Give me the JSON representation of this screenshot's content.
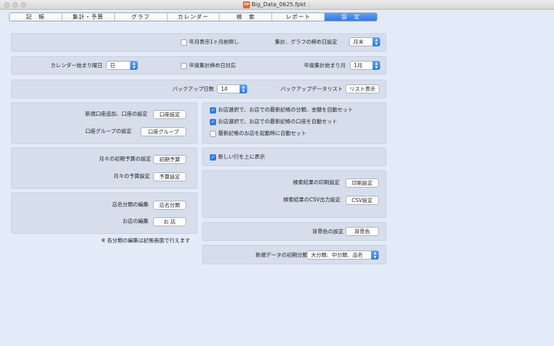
{
  "window": {
    "title": "Big_Data_0625.fpkt",
    "app_icon": "FP"
  },
  "tabs": [
    "記　帳",
    "集計・予算",
    "グラフ",
    "カレンダー",
    "検　索",
    "レポート",
    "設　定"
  ],
  "row1": {
    "checkbox_label": "年月表示1ヶ月前倒し",
    "closing_label": "集計、グラフの締め日設定",
    "closing_value": "月末"
  },
  "row2": {
    "weekstart_label": "カレンダー始まり曜日",
    "weekstart_value": "日",
    "checkbox_label": "年度集計締め日対応",
    "fiscal_label": "年度集計始まり月",
    "fiscal_value": "1月"
  },
  "row3": {
    "backup_days_label": "バックアップ日数",
    "backup_days_value": "14",
    "backup_list_label": "バックアップデータリスト",
    "backup_list_button": "リスト表示"
  },
  "account": {
    "new_account_label": "新規口座追加、口座の設定",
    "new_account_button": "口座設定",
    "group_label": "口座グループの設定",
    "group_button": "口座グループ"
  },
  "autoset": {
    "cb1_label": "お店選択で、お店での最新記帳の分類、金額を自動セット",
    "cb2_label": "お店選択で、お店での最新記帳の口座を自動セット",
    "cb3_label": "最新記帳のお店を起動時に自動セット"
  },
  "budget": {
    "initial_label": "月々の初期予算の設定",
    "initial_button": "初期予算",
    "monthly_label": "月々の予算設定",
    "monthly_button": "予算設定"
  },
  "newrow": {
    "cb_label": "新しい行を上に表示"
  },
  "shop": {
    "category_label": "店名分類の編集",
    "category_button": "店名分類",
    "shop_label": "お店の編集",
    "shop_button": "お 店"
  },
  "note": "※ 各分類の編集は記帳画面で行えます",
  "print": {
    "print_label": "検索結果の印刷設定",
    "print_button": "印刷設定",
    "csv_label": "検索結果のCSV出力設定",
    "csv_button": "CSV設定"
  },
  "bg": {
    "label": "背景色の設定",
    "button": "背景色"
  },
  "newdata": {
    "label": "新規データの初期分類",
    "value": "大分類、中分類、品名"
  },
  "colors": {
    "accent": "#2a78ee",
    "content_bg": "#e4ebf8",
    "panel_bg": "#d6deec"
  }
}
